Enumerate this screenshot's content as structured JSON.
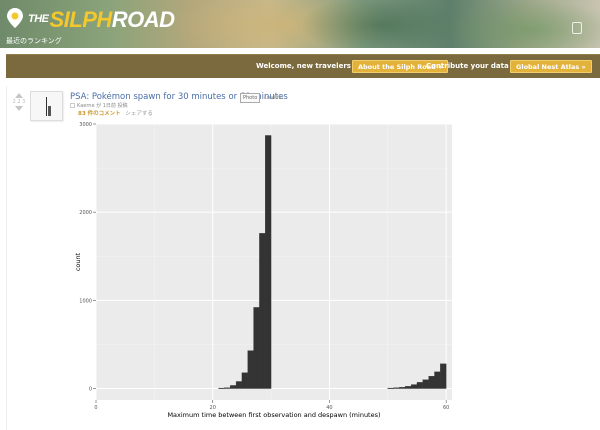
{
  "header": {
    "logo_the": "THE",
    "logo_silph": "SILPH",
    "logo_road": "ROAD",
    "subtitle": "最近のランキング",
    "logo_icon": "map-pin-icon"
  },
  "welcome_bar": {
    "welcome_text": "Welcome, new travelers! Learn:",
    "about_button": "About the Silph Road »",
    "contribute_text": "Contribute your data to the",
    "atlas_button": "Global Nest Atlas »"
  },
  "post": {
    "score": "2 2 3",
    "title": "PSA: Pokémon spawn for 30 minutes or 60 minutes",
    "flair": "Photo",
    "domain": "i.redd.it",
    "meta": "Kaerne  が 1日前 投稿",
    "comments_label": "83 件のコメント",
    "share_label": "シェアする",
    "accent_color": "#c9962a",
    "title_color": "#4a6ea8"
  },
  "chart_data": {
    "type": "histogram",
    "xlabel": "Maximum time between first observation and despawn (minutes)",
    "ylabel": "count",
    "xlim": [
      0,
      61
    ],
    "ylim": [
      -130,
      3000
    ],
    "x_ticks": [
      0,
      20,
      40,
      60
    ],
    "y_ticks": [
      0,
      1000,
      2000,
      3000
    ],
    "grid": true,
    "bins": [
      {
        "x0": 21,
        "x1": 22,
        "count": 5
      },
      {
        "x0": 22,
        "x1": 23,
        "count": 10
      },
      {
        "x0": 23,
        "x1": 24,
        "count": 35
      },
      {
        "x0": 24,
        "x1": 25,
        "count": 80
      },
      {
        "x0": 25,
        "x1": 26,
        "count": 180
      },
      {
        "x0": 26,
        "x1": 27,
        "count": 430
      },
      {
        "x0": 27,
        "x1": 28,
        "count": 920
      },
      {
        "x0": 28,
        "x1": 29,
        "count": 1760
      },
      {
        "x0": 29,
        "x1": 30,
        "count": 2870
      },
      {
        "x0": 50,
        "x1": 51,
        "count": 5
      },
      {
        "x0": 51,
        "x1": 52,
        "count": 10
      },
      {
        "x0": 52,
        "x1": 53,
        "count": 15
      },
      {
        "x0": 53,
        "x1": 54,
        "count": 25
      },
      {
        "x0": 54,
        "x1": 55,
        "count": 45
      },
      {
        "x0": 55,
        "x1": 56,
        "count": 70
      },
      {
        "x0": 56,
        "x1": 57,
        "count": 100
      },
      {
        "x0": 57,
        "x1": 58,
        "count": 140
      },
      {
        "x0": 58,
        "x1": 59,
        "count": 190
      },
      {
        "x0": 59,
        "x1": 60,
        "count": 280
      }
    ]
  }
}
